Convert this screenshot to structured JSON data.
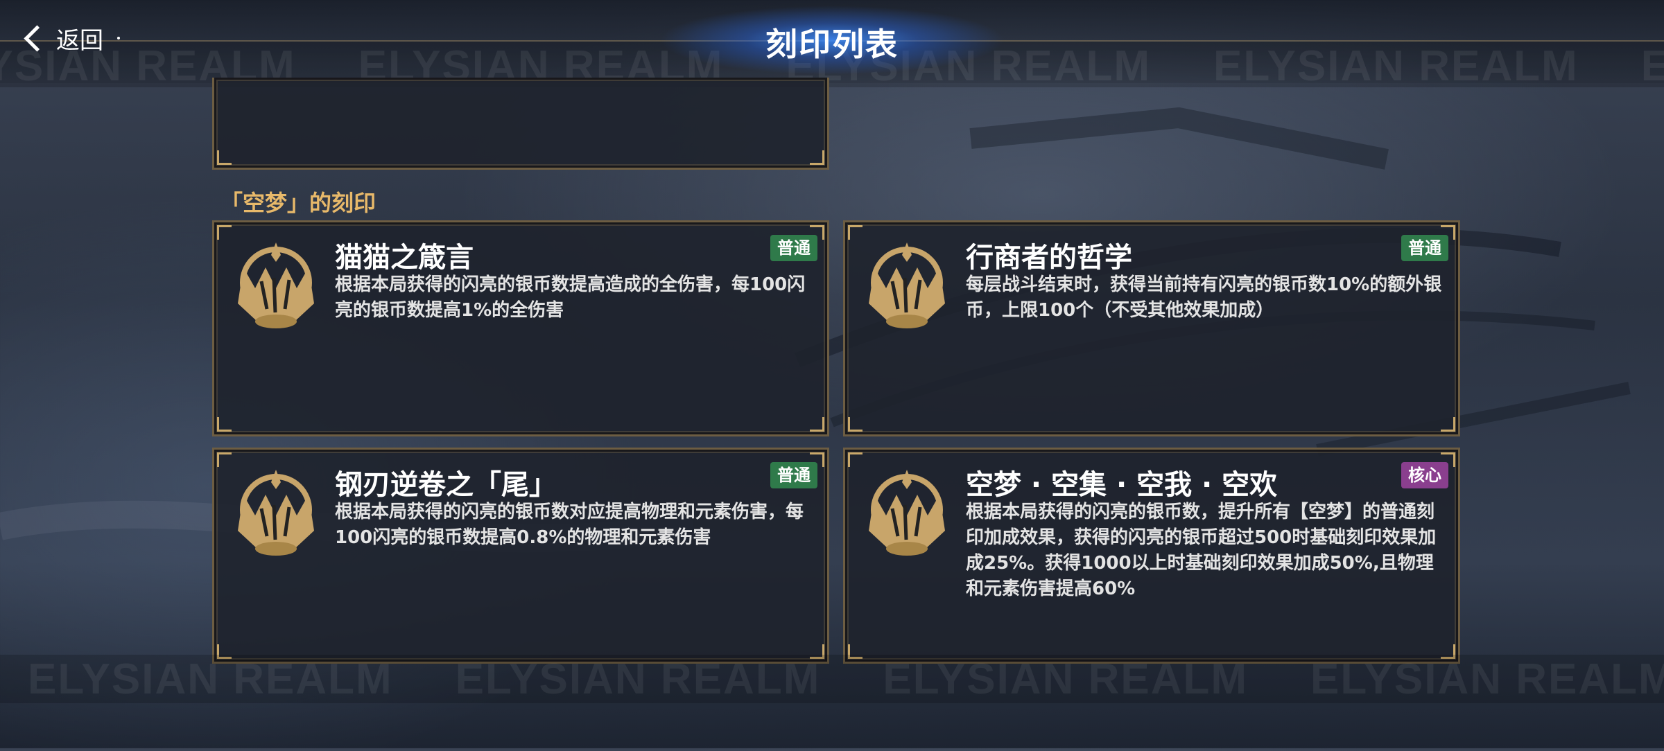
{
  "header": {
    "title": "刻印列表",
    "back_label": "返回"
  },
  "watermark": {
    "text": "ELYSIAN REALM"
  },
  "section": {
    "title": "「空梦」的刻印"
  },
  "colors": {
    "accent": "#e8b96a",
    "badge_common": "#2f7a4a",
    "badge_core": "#8a3f8e",
    "card_border": "#6d5d42",
    "emblem_gold": "#c8a56a"
  },
  "cards": [
    {
      "name": "猫猫之箴言",
      "badge": "普通",
      "badge_type": "common",
      "description": "根据本局获得的闪亮的银币数提高造成的全伤害，每100闪亮的银币数提高1%的全伤害",
      "icon": "emblem-icon"
    },
    {
      "name": "行商者的哲学",
      "badge": "普通",
      "badge_type": "common",
      "description": "每层战斗结束时，获得当前持有闪亮的银币数10%的额外银币，上限100个（不受其他效果加成）",
      "icon": "emblem-icon"
    },
    {
      "name": "钢刃逆卷之「尾」",
      "badge": "普通",
      "badge_type": "common",
      "description": "根据本局获得的闪亮的银币数对应提高物理和元素伤害，每100闪亮的银币数提高0.8%的物理和元素伤害",
      "icon": "emblem-icon"
    },
    {
      "name": "空梦 · 空集 · 空我 · 空欢",
      "badge": "核心",
      "badge_type": "core",
      "description": "根据本局获得的闪亮的银币数，提升所有【空梦】的普通刻印加成效果，获得的闪亮的银币超过500时基础刻印效果加成25%。获得1000以上时基础刻印效果加成50%,且物理和元素伤害提高60%",
      "icon": "emblem-icon"
    }
  ]
}
